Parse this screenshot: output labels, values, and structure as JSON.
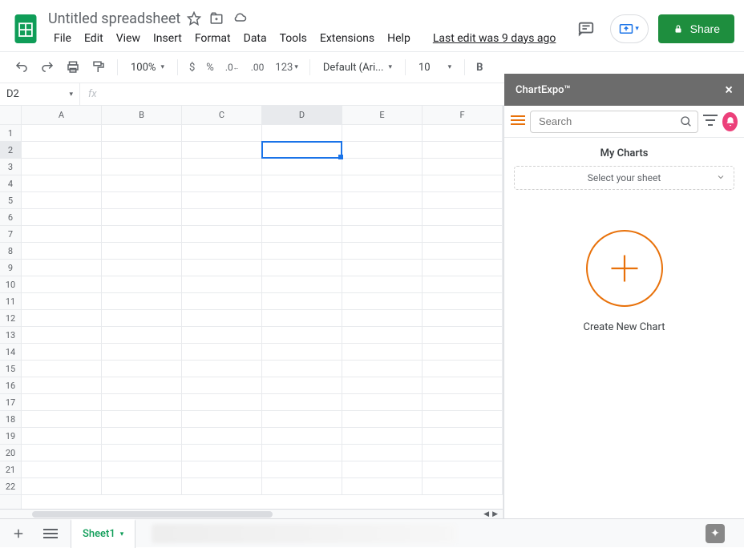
{
  "titlebar": {
    "doc_title": "Untitled spreadsheet",
    "share_label": "Share",
    "last_edit": "Last edit was 9 days ago"
  },
  "menubar": [
    "File",
    "Edit",
    "View",
    "Insert",
    "Format",
    "Data",
    "Tools",
    "Extensions",
    "Help"
  ],
  "toolbar": {
    "zoom": "100%",
    "font": "Default (Ari...",
    "font_size": "10"
  },
  "formula": {
    "active_cell": "D2"
  },
  "grid": {
    "columns": [
      "A",
      "B",
      "C",
      "D",
      "E",
      "F"
    ],
    "rows": [
      "1",
      "2",
      "3",
      "4",
      "5",
      "6",
      "7",
      "8",
      "9",
      "10",
      "11",
      "12",
      "13",
      "14",
      "15",
      "16",
      "17",
      "18",
      "19",
      "20",
      "21",
      "22"
    ],
    "selected_col_index": 3,
    "selected_row_index": 1
  },
  "sidepanel": {
    "title": "ChartExpo™",
    "search_placeholder": "Search",
    "mycharts_title": "My Charts",
    "select_sheet": "Select your sheet",
    "create_label": "Create New Chart"
  },
  "sheets": {
    "active_tab": "Sheet1"
  }
}
